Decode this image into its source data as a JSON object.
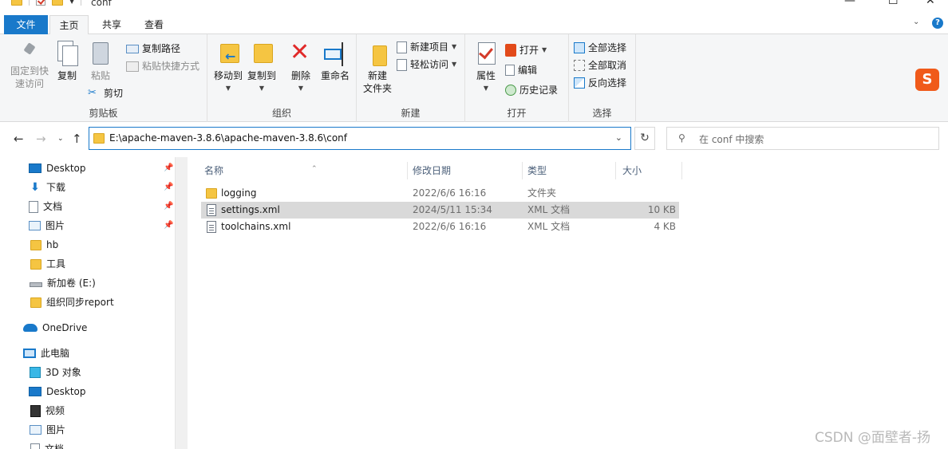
{
  "window": {
    "title": "conf",
    "controls": {
      "minimize": "—",
      "maximize": "☐",
      "close": "✕"
    }
  },
  "ribbon_tabs": [
    "文件",
    "主页",
    "共享",
    "查看"
  ],
  "ribbon": {
    "clipboard": {
      "label": "剪贴板",
      "pin_quick_access": [
        "固定到快",
        "速访问"
      ],
      "copy": "复制",
      "paste": "粘贴",
      "copy_path": "复制路径",
      "paste_shortcut": "粘贴快捷方式",
      "cut": "剪切"
    },
    "organize": {
      "label": "组织",
      "move_to": "移动到",
      "copy_to": "复制到",
      "delete": "删除",
      "rename": "重命名"
    },
    "new": {
      "label": "新建",
      "new_folder": [
        "新建",
        "文件夹"
      ],
      "new_item": "新建项目",
      "easy_access": "轻松访问"
    },
    "open": {
      "label": "打开",
      "properties": "属性",
      "open": "打开",
      "edit": "编辑",
      "history": "历史记录"
    },
    "select": {
      "label": "选择",
      "select_all": "全部选择",
      "select_none": "全部取消",
      "invert": "反向选择"
    }
  },
  "address": {
    "path": "E:\\apache-maven-3.8.6\\apache-maven-3.8.6\\conf",
    "search_placeholder": "在 conf 中搜索"
  },
  "nav_pane": {
    "quick_access": [
      {
        "label": "Desktop",
        "icon": "desktop-icon",
        "pinned": true
      },
      {
        "label": "下载",
        "icon": "download-icon",
        "pinned": true
      },
      {
        "label": "文档",
        "icon": "documents-icon",
        "pinned": true
      },
      {
        "label": "图片",
        "icon": "pictures-icon",
        "pinned": true
      },
      {
        "label": "hb",
        "icon": "folder-icon",
        "pinned": false
      },
      {
        "label": "工具",
        "icon": "folder-icon",
        "pinned": false
      },
      {
        "label": "新加卷 (E:)",
        "icon": "drive-icon",
        "pinned": false
      },
      {
        "label": "组织同步report",
        "icon": "folder-icon",
        "pinned": false
      }
    ],
    "onedrive": "OneDrive",
    "this_pc": "此电脑",
    "pc_items": [
      {
        "label": "3D 对象",
        "icon": "3d-objects-icon"
      },
      {
        "label": "Desktop",
        "icon": "desktop-icon"
      },
      {
        "label": "视频",
        "icon": "video-icon"
      },
      {
        "label": "图片",
        "icon": "pictures-icon"
      },
      {
        "label": "文档",
        "icon": "documents-icon"
      }
    ]
  },
  "file_list": {
    "columns": [
      "名称",
      "修改日期",
      "类型",
      "大小"
    ],
    "rows": [
      {
        "name": "logging",
        "modified": "2022/6/6 16:16",
        "type": "文件夹",
        "size": "",
        "icon": "folder-icon",
        "selected": false
      },
      {
        "name": "settings.xml",
        "modified": "2024/5/11 15:34",
        "type": "XML 文档",
        "size": "10 KB",
        "icon": "xml-file-icon",
        "selected": true
      },
      {
        "name": "toolchains.xml",
        "modified": "2022/6/6 16:16",
        "type": "XML 文档",
        "size": "4 KB",
        "icon": "xml-file-icon",
        "selected": false
      }
    ]
  },
  "overlay": {
    "sogou": "S",
    "watermark": "CSDN @面壁者-扬"
  }
}
